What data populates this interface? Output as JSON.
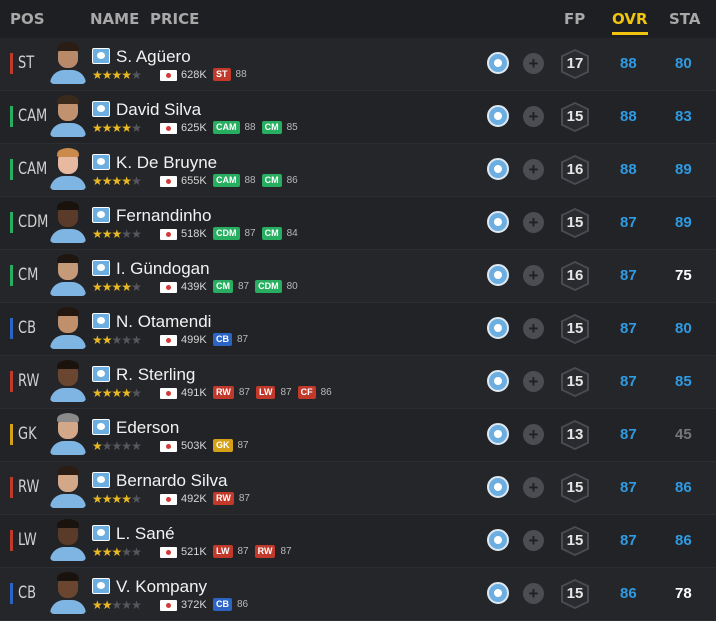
{
  "header": {
    "pos": "POS",
    "name": "NAME",
    "price": "PRICE",
    "fp": "FP",
    "ovr": "OVR",
    "sta": "STA"
  },
  "colors": {
    "forward": "#c0392b",
    "midfielder": "#27ae60",
    "defender": "#2c64c4",
    "goalkeeper": "#d4a017",
    "ovr": "#2e9be3",
    "sta_blue": "#2e9be3",
    "sta_white": "#ffffff",
    "sta_grey": "#777777"
  },
  "icons": {
    "club": "manchester-city-crest-icon",
    "add": "plus-circle-icon",
    "flag": "south-korea-flag-icon",
    "star": "star-icon"
  },
  "players": [
    {
      "pos": "ST",
      "pos_group": "forward",
      "name": "S. Agüero",
      "stars": 4,
      "price": "628K",
      "positions": [
        {
          "label": "ST",
          "group": "forward",
          "value": "88"
        }
      ],
      "fp": "17",
      "ovr": "88",
      "sta": "80",
      "sta_color": "blue",
      "skin": "#b88a6a",
      "hair": "#2b1d14"
    },
    {
      "pos": "CAM",
      "pos_group": "midfielder",
      "name": "David Silva",
      "stars": 4,
      "price": "625K",
      "positions": [
        {
          "label": "CAM",
          "group": "midfielder",
          "value": "88"
        },
        {
          "label": "CM",
          "group": "midfielder",
          "value": "85"
        }
      ],
      "fp": "15",
      "ovr": "88",
      "sta": "83",
      "sta_color": "blue",
      "skin": "#c09270",
      "hair": "#3a2a1c"
    },
    {
      "pos": "CAM",
      "pos_group": "midfielder",
      "name": "K. De Bruyne",
      "stars": 4,
      "price": "655K",
      "positions": [
        {
          "label": "CAM",
          "group": "midfielder",
          "value": "88"
        },
        {
          "label": "CM",
          "group": "midfielder",
          "value": "86"
        }
      ],
      "fp": "16",
      "ovr": "88",
      "sta": "89",
      "sta_color": "blue",
      "skin": "#e6b9a0",
      "hair": "#c98a4c"
    },
    {
      "pos": "CDM",
      "pos_group": "midfielder",
      "name": "Fernandinho",
      "stars": 3,
      "price": "518K",
      "positions": [
        {
          "label": "CDM",
          "group": "midfielder",
          "value": "87"
        },
        {
          "label": "CM",
          "group": "midfielder",
          "value": "84"
        }
      ],
      "fp": "15",
      "ovr": "87",
      "sta": "89",
      "sta_color": "blue",
      "skin": "#5a3a28",
      "hair": "#1a120c"
    },
    {
      "pos": "CM",
      "pos_group": "midfielder",
      "name": "I. Gündogan",
      "stars": 4,
      "price": "439K",
      "positions": [
        {
          "label": "CM",
          "group": "midfielder",
          "value": "87"
        },
        {
          "label": "CDM",
          "group": "midfielder",
          "value": "80"
        }
      ],
      "fp": "16",
      "ovr": "87",
      "sta": "75",
      "sta_color": "white",
      "skin": "#c49a78",
      "hair": "#1e1610"
    },
    {
      "pos": "CB",
      "pos_group": "defender",
      "name": "N. Otamendi",
      "stars": 2,
      "price": "499K",
      "positions": [
        {
          "label": "CB",
          "group": "defender",
          "value": "87"
        }
      ],
      "fp": "15",
      "ovr": "87",
      "sta": "80",
      "sta_color": "blue",
      "skin": "#c0906c",
      "hair": "#22180f"
    },
    {
      "pos": "RW",
      "pos_group": "forward",
      "name": "R. Sterling",
      "stars": 4,
      "price": "491K",
      "positions": [
        {
          "label": "RW",
          "group": "forward",
          "value": "87"
        },
        {
          "label": "LW",
          "group": "forward",
          "value": "87"
        },
        {
          "label": "CF",
          "group": "forward",
          "value": "86"
        }
      ],
      "fp": "15",
      "ovr": "87",
      "sta": "85",
      "sta_color": "blue",
      "skin": "#6a4530",
      "hair": "#1a120c"
    },
    {
      "pos": "GK",
      "pos_group": "goalkeeper",
      "name": "Ederson",
      "stars": 1,
      "price": "503K",
      "positions": [
        {
          "label": "GK",
          "group": "goalkeeper",
          "value": "87"
        }
      ],
      "fp": "13",
      "ovr": "87",
      "sta": "45",
      "sta_color": "grey",
      "skin": "#d2a888",
      "hair": "#8a8a8a"
    },
    {
      "pos": "RW",
      "pos_group": "forward",
      "name": "Bernardo Silva",
      "stars": 4,
      "price": "492K",
      "positions": [
        {
          "label": "RW",
          "group": "forward",
          "value": "87"
        }
      ],
      "fp": "15",
      "ovr": "87",
      "sta": "86",
      "sta_color": "blue",
      "skin": "#d2a888",
      "hair": "#2b1d14"
    },
    {
      "pos": "LW",
      "pos_group": "forward",
      "name": "L. Sané",
      "stars": 3,
      "price": "521K",
      "positions": [
        {
          "label": "LW",
          "group": "forward",
          "value": "87"
        },
        {
          "label": "RW",
          "group": "forward",
          "value": "87"
        }
      ],
      "fp": "15",
      "ovr": "87",
      "sta": "86",
      "sta_color": "blue",
      "skin": "#5a3a28",
      "hair": "#1a120c"
    },
    {
      "pos": "CB",
      "pos_group": "defender",
      "name": "V. Kompany",
      "stars": 2,
      "price": "372K",
      "positions": [
        {
          "label": "CB",
          "group": "defender",
          "value": "86"
        }
      ],
      "fp": "15",
      "ovr": "86",
      "sta": "78",
      "sta_color": "white",
      "skin": "#6a4530",
      "hair": "#1a120c"
    }
  ]
}
